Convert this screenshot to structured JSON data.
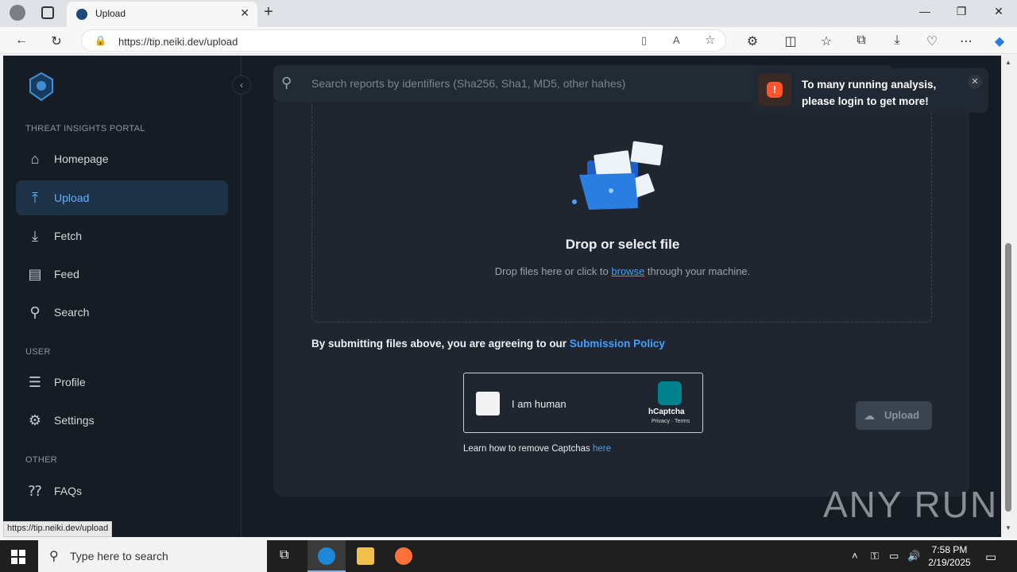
{
  "browser": {
    "tab_title": "Upload",
    "url": "https://tip.neiki.dev/upload",
    "status_url": "https://tip.neiki.dev/upload"
  },
  "sidebar": {
    "section_portal": "THREAT INSIGHTS PORTAL",
    "section_user": "USER",
    "section_other": "OTHER",
    "items": [
      {
        "label": "Homepage",
        "icon": "home-icon"
      },
      {
        "label": "Upload",
        "icon": "upload-icon",
        "active": true
      },
      {
        "label": "Fetch",
        "icon": "download-icon"
      },
      {
        "label": "Feed",
        "icon": "feed-icon"
      },
      {
        "label": "Search",
        "icon": "search-icon"
      },
      {
        "label": "Profile",
        "icon": "profile-icon"
      },
      {
        "label": "Settings",
        "icon": "gear-icon"
      },
      {
        "label": "FAQs",
        "icon": "faq-icon"
      }
    ]
  },
  "search": {
    "placeholder": "Search reports by identifiers (Sha256, Sha1, MD5, other hahes)"
  },
  "dropzone": {
    "title": "Drop or select file",
    "sub_before": "Drop files here or click to ",
    "sub_link": "browse",
    "sub_after": " through your machine."
  },
  "agreement": {
    "text": "By submitting files above, you are agreeing to our ",
    "link": "Submission Policy"
  },
  "captcha": {
    "label": "I am human",
    "brand": "hCaptcha",
    "terms": "Privacy · Terms"
  },
  "howto": {
    "text": "Learn how to remove Captchas ",
    "link": "here"
  },
  "upload_button": {
    "label": "Upload"
  },
  "toast": {
    "message": "To many running analysis, please login to get more!",
    "accent": "#ff5630"
  },
  "watermark": "ANY RUN",
  "taskbar": {
    "search_placeholder": "Type here to search",
    "time": "7:58 PM",
    "date": "2/19/2025"
  }
}
